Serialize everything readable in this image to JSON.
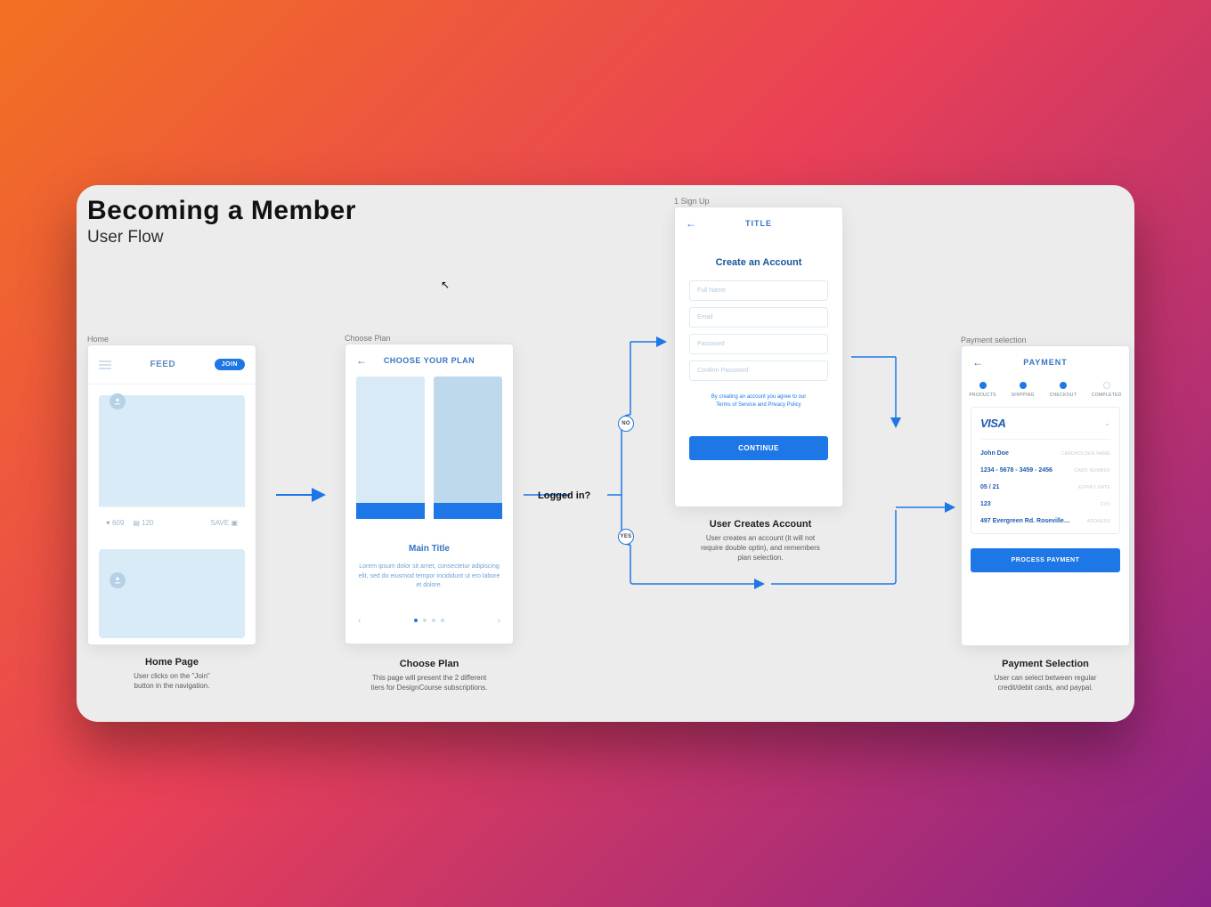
{
  "titles": {
    "main": "Becoming a Member",
    "sub": "User Flow"
  },
  "frames": {
    "home": {
      "label": "Home",
      "feed": "FEED",
      "join": "JOIN",
      "likes": "609",
      "comments": "120",
      "save": "SAVE",
      "caption_title": "Home Page",
      "caption_desc": "User clicks on the \"Join\" button in the navigation."
    },
    "plan": {
      "label": "Choose Plan",
      "title": "CHOOSE YOUR PLAN",
      "main_title": "Main Title",
      "desc": "Lorem ipsum dolor sit amet, consectetur adipiscing elit, sed do eiusmod tempor incididunt ut ero labore et dolore.",
      "caption_title": "Choose Plan",
      "caption_desc": "This page will present the 2 different tiers for DesignCourse subscriptions."
    },
    "signup": {
      "label": "1 Sign Up",
      "top_title": "TITLE",
      "heading": "Create an Account",
      "ph_name": "Full Name",
      "ph_email": "Email",
      "ph_pw": "Password",
      "ph_cpw": "Confirm Password",
      "terms_a": "By creating an account you agree to our",
      "terms_b": "Terms of Service",
      "terms_c": "and",
      "terms_d": "Privacy Policy",
      "continue": "CONTINUE",
      "caption_title": "User Creates Account",
      "caption_desc": "User creates an account (it will not require double optin), and remembers plan selection."
    },
    "payment": {
      "label": "Payment selection",
      "top_title": "PAYMENT",
      "steps": [
        "PRODUCTS",
        "SHIPPING",
        "CHECKOUT",
        "COMPLETED"
      ],
      "visa": "VISA",
      "holder": "John Doe",
      "holder_l": "CARDHOLDER NAME",
      "number": "1234 - 5678 - 3459 - 2456",
      "number_l": "CARD NUMBER",
      "expiry": "05 / 21",
      "expiry_l": "EXPIRY DATE",
      "cvv": "123",
      "cvv_l": "CVV",
      "addr": "497 Evergreen Rd. Roseville…",
      "addr_l": "ADDRESS",
      "process": "PROCESS PAYMENT",
      "caption_title": "Payment Selection",
      "caption_desc": "User can select between regular credit/debit cards, and paypal."
    }
  },
  "decision": {
    "question": "Logged in?",
    "no": "NO",
    "yes": "YES"
  }
}
